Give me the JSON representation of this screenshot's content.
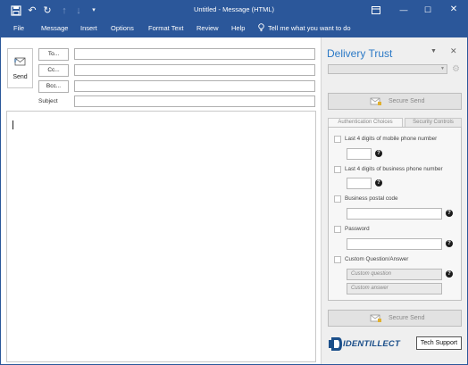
{
  "titlebar": {
    "title": "Untitled  -  Message (HTML)",
    "icons": [
      "save-icon",
      "undo-icon",
      "redo-icon",
      "up-arrow-icon",
      "down-arrow-icon",
      "customize-icon"
    ],
    "controls": [
      "restore-icon",
      "minimize-icon",
      "maximize-icon",
      "close-icon"
    ]
  },
  "menu": {
    "file": "File",
    "message": "Message",
    "insert": "Insert",
    "options": "Options",
    "format_text": "Format Text",
    "review": "Review",
    "help": "Help",
    "tell_me": "Tell me what you want to do"
  },
  "compose": {
    "send_label": "Send",
    "to_label": "To...",
    "cc_label": "Cc...",
    "bcc_label": "Bcc...",
    "subject_label": "Subject",
    "to_value": "",
    "cc_value": "",
    "bcc_value": "",
    "subject_value": "",
    "body_value": ""
  },
  "panel": {
    "title": "Delivery Trust",
    "menu_icon": "triangle-down-icon",
    "close_icon": "close-icon",
    "settings_icon": "gear-icon",
    "secure_send_top": "Secure Send",
    "secure_send_bottom": "Secure Send",
    "tabs": [
      {
        "label": "Authentication Choices",
        "active": true
      },
      {
        "label": "Security Controls",
        "active": false
      }
    ],
    "options": {
      "mobile": "Last 4 digits of mobile phone number",
      "business_phone": "Last 4 digits of business phone number",
      "postal": "Business postal code",
      "password": "Password",
      "custom_qa": "Custom Question/Answer"
    },
    "placeholders": {
      "custom_question": "Custom question",
      "custom_answer": "Custom answer"
    },
    "help_glyph": "?",
    "logo_text": "IDENTILLECT",
    "tech_support": "Tech Support"
  },
  "colors": {
    "brand": "#2b579a",
    "panel_title": "#2b79c6",
    "panel_bg": "#efefef"
  }
}
